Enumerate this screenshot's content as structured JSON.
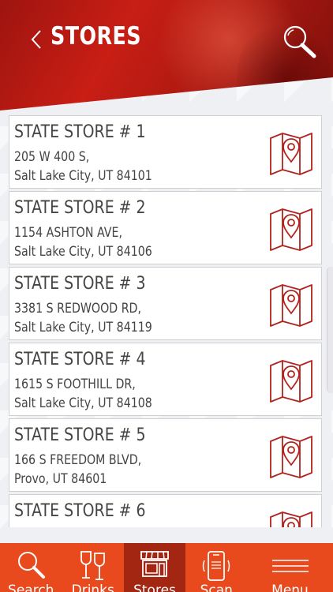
{
  "header": {
    "title": "STORES"
  },
  "stores": [
    {
      "name": "STATE STORE # 1",
      "line1": "205 W 400 S,",
      "line2": "Salt Lake City, UT 84101"
    },
    {
      "name": "STATE STORE # 2",
      "line1": "1154 ASHTON AVE,",
      "line2": "Salt Lake City, UT 84106"
    },
    {
      "name": "STATE STORE # 3",
      "line1": "3381 S REDWOOD RD,",
      "line2": "Salt Lake City, UT 84119"
    },
    {
      "name": "STATE STORE # 4",
      "line1": "1615 S FOOTHILL DR,",
      "line2": "Salt Lake City, UT 84108"
    },
    {
      "name": "STATE STORE # 5",
      "line1": "166 S FREEDOM BLVD,",
      "line2": "Provo, UT 84601"
    },
    {
      "name": "STATE STORE # 6",
      "line1": "",
      "line2": ""
    }
  ],
  "tabs": [
    {
      "label": "Search",
      "icon": "search-icon"
    },
    {
      "label": "Drinks",
      "icon": "wine-glasses-icon"
    },
    {
      "label": "Stores",
      "icon": "storefront-icon",
      "active": true
    },
    {
      "label": "Scan",
      "icon": "phone-scan-icon"
    },
    {
      "label": "Menu",
      "icon": "hamburger-icon"
    }
  ],
  "colors": {
    "brand": "#e84a1e",
    "active_tab": "#a32612",
    "header": "#c81e14",
    "map_icon": "#b0231c"
  }
}
